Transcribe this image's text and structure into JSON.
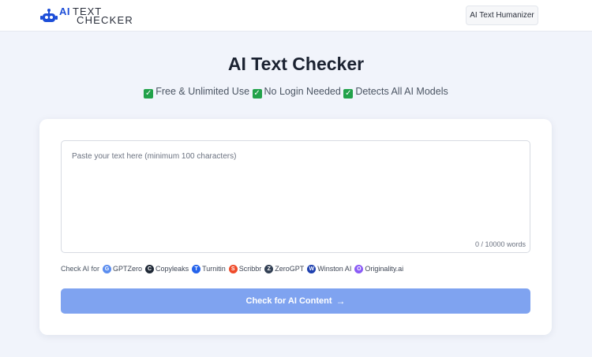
{
  "header": {
    "logo_ai": "AI",
    "logo_text": "TEXT",
    "logo_checker": "CHECKER",
    "humanizer_label": "AI Text Humanizer"
  },
  "main": {
    "title": "AI Text Checker",
    "features": [
      "Free & Unlimited Use",
      "No Login Needed",
      "Detects All AI Models"
    ],
    "textarea_placeholder": "Paste your text here (minimum 100 characters)",
    "word_count": "0 / 10000 words",
    "check_for_label": "Check AI for",
    "detectors": [
      {
        "name": "GPTZero",
        "icon": "gptzero-icon",
        "color": "#5b8def",
        "glyph": "G"
      },
      {
        "name": "Copyleaks",
        "icon": "copyleaks-icon",
        "color": "#1f2937",
        "glyph": "C"
      },
      {
        "name": "Turnitin",
        "icon": "turnitin-icon",
        "color": "#2563eb",
        "glyph": "T"
      },
      {
        "name": "Scribbr",
        "icon": "scribbr-icon",
        "color": "#ef4b2a",
        "glyph": "S"
      },
      {
        "name": "ZeroGPT",
        "icon": "zerogpt-icon",
        "color": "#334155",
        "glyph": "Z"
      },
      {
        "name": "Winston AI",
        "icon": "winston-icon",
        "color": "#1e40af",
        "glyph": "W"
      },
      {
        "name": "Originality.ai",
        "icon": "originality-icon",
        "color": "#8b5cf6",
        "glyph": "O"
      }
    ],
    "submit_label": "Check for AI Content"
  },
  "colors": {
    "accent": "#1d4ed8",
    "button": "#7fa3f0",
    "check": "#22a24a"
  }
}
